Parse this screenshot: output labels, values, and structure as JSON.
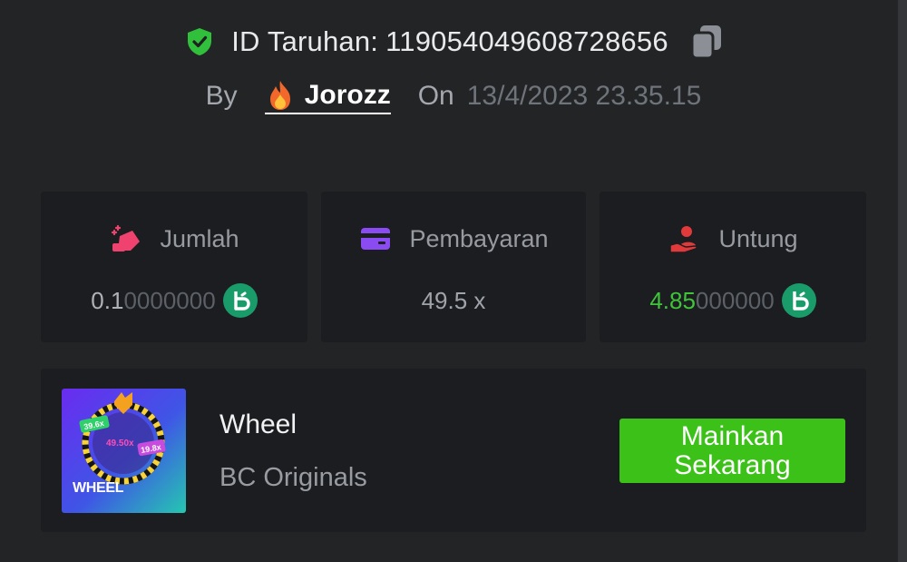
{
  "header": {
    "bet_id_label": "ID Taruhan:",
    "bet_id_value": "119054049608728656",
    "by_label": "By",
    "username": "Jorozz",
    "on_label": "On",
    "timestamp": "13/4/2023 23.35.15"
  },
  "stats": {
    "amount": {
      "label": "Jumlah",
      "value_lit": "0.1",
      "value_dim": "0000000",
      "icon": "bet-amount-icon"
    },
    "payout": {
      "label": "Pembayaran",
      "value": "49.5 x",
      "icon": "card-icon"
    },
    "profit": {
      "label": "Untung",
      "value_lit": "4.85",
      "value_dim": "000000",
      "icon": "profit-hand-icon"
    }
  },
  "game": {
    "thumb_label": "WHEEL",
    "thumb_multipliers": [
      "39.6x",
      "49.50x",
      "19.8x"
    ],
    "name": "Wheel",
    "provider": "BC Originals",
    "play_button": "Mainkan Sekarang"
  },
  "colors": {
    "background": "#232426",
    "card": "#1c1d20",
    "accent_green": "#3bc117",
    "profit_green": "#3fc43a",
    "coin": "#1a9b6a"
  }
}
